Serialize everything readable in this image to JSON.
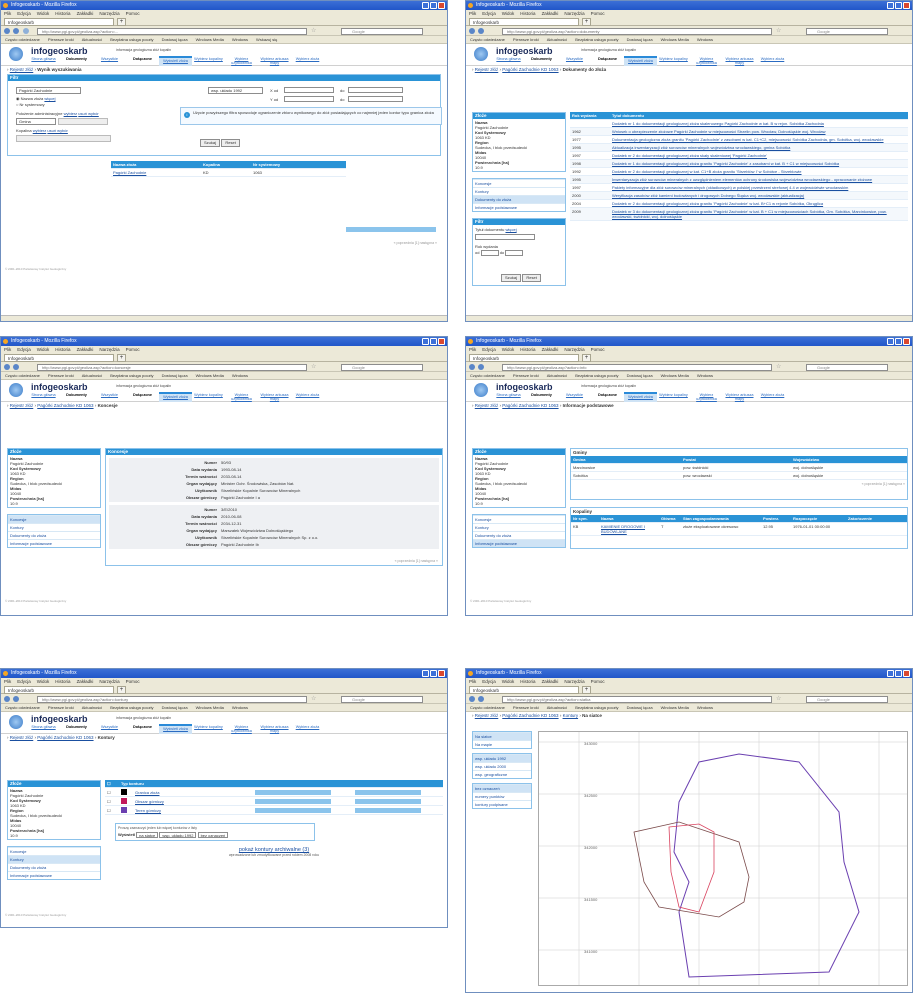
{
  "browser": {
    "title": "Infogeoskarb - Mozilla Firefox",
    "menu": [
      "Plik",
      "Edycja",
      "Widok",
      "Historia",
      "Zakładki",
      "Narzędzia",
      "Pomoc"
    ],
    "tab": "Infogeoskarb",
    "bookmarks": [
      "Często odwiedzane",
      "Pierwsze kroki",
      "Aktualności",
      "Bezpłatna usługa poczty",
      "Dostosuj łącza",
      "Windows Media",
      "Windows",
      "Wskazuj się"
    ],
    "search": "Google"
  },
  "site": {
    "logo": "infogeoskarb",
    "tagline": "informacja geologiczna złóż kopalin",
    "nav": [
      "Strona główna",
      "Dokumenty",
      "Wszystkie",
      "Dołączone",
      "Wyświetl złoża",
      "Wybierz kopaliny",
      "Wybierz użytkownika",
      "Wybierz arkusza mapy",
      "Wybierz złoża"
    ]
  },
  "colors": {
    "header": "#2a93d6",
    "link": "#1a4fa0",
    "frame": "#2156c9"
  },
  "w1": {
    "url": "http://www.pgi.gov.pl/geoliza.asp?action=...",
    "breadcrumb": [
      "Rejestr złóż",
      "Wynik wyszukiwania"
    ],
    "filter_header": "Filtr",
    "name_value": "Pagórki Zachodnie",
    "radio1": "Nazwa złoża",
    "radio2": "Nr systemowy",
    "admin_label": "Położenie administracyjne",
    "admin_link1": "wybierz",
    "admin_link2": "usuń wybór",
    "gmina": "Gmina",
    "kopalina_label": "Kopalina",
    "kop_link1": "wybierz",
    "kop_link2": "usuń wybór",
    "coord_select": "wsp. układu 1992",
    "x_label": "X od",
    "y_label": "Y od",
    "do": "do",
    "info": "Użycie powyższego filtra spowoduje ograniczenie zbioru wynikowego do złóż posiadających co najmniej jeden kontur typu granica złoża",
    "search_btn": "Szukaj",
    "reset_btn": "Reset",
    "col_name": "Nazwa złoża",
    "col_kop": "Kopalina",
    "col_nr": "Nr systemowy",
    "result_name": "Pagórki Zachodnie",
    "result_kop": "KD",
    "result_nr": "1063",
    "pager": "« poprzednia [1] następna »",
    "footer": "© 2001-2010 Państwowy Instytut Geologiczny"
  },
  "side": {
    "header": "Złoże",
    "nazwa_l": "Nazwa",
    "nazwa": "Pagórki Zachodnie",
    "kod_l": "Kod Systemowy",
    "kod": "1063 KD",
    "region_l": "Region",
    "region": "Sudecka, I blok przedsudecki",
    "midas_l": "Midas",
    "midas": "10040",
    "pow_l": "Powierzchnia [ha]",
    "pow": "10.9",
    "links": [
      "Koncesje",
      "Kontury",
      "Dokumenty do złoża",
      "Informacje podstawowe"
    ]
  },
  "w2": {
    "url": "http://www.pgi.gov.pl/geoliza.asp?action=dokumenty",
    "breadcrumb": [
      "Rejestr złóż",
      "Pagórki Zachodnie KD 1063",
      "Dokumenty do złoża"
    ],
    "col_year": "Rok wydania",
    "col_title": "Tytuł dokumentu",
    "docs": [
      {
        "y": "",
        "t": "Dodatek nr 1 do dokumentacji geologicznej złoża skalenowego Pagórki Zachodnie w kat. B w rejon. Sobótka Zachodnia"
      },
      {
        "y": "1962",
        "t": "Wniosek o ubezpieczenie złożowe Pagórki Zachodnie w miejscowości Strzelin pow. Wrocław, Dolnośląskie woj. Wrocław"
      },
      {
        "y": "1977",
        "t": "Dokumentacja geologiczna złoża granitu 'Pagórki Zachodnie' z zasobami w kat. C1+C2, miejscowość Sobótka Zachodnia, gm. Sobótka, woj. wrocławskie"
      },
      {
        "y": "1995",
        "t": "Aktualizacja inwentaryzacji złóż surowców mineralnych województwa wrocławskiego, gmina Sobótka"
      },
      {
        "y": "1997",
        "t": "Dodatek nr 2 do dokumentacji geologicznej złoża skały skaleniowej 'Pagórki Zachodnie'"
      },
      {
        "y": "1998",
        "t": "Dodatek nr 1 do dokumentacji geologicznej złoża granitu 'Pagórki Zachodnie' z zasobami w kat. B + C1 w miejscowości Sobótka"
      },
      {
        "y": "1992",
        "t": "Dodatek nr 2 do dokumentacji geologicznej w kat. C1+B złoża granitu 'Strzeblów I' w Sobótce - Strzeblowie"
      },
      {
        "y": "1995",
        "t": "Inwentaryzacja złóż surowców mineralnych z uwzględnieniem elementów ochrony środowiska województwa wrocławskiego - opracowanie złożowe"
      },
      {
        "y": "1997",
        "t": "Pakiety informacyjne dla złóż surowców mineralnych (okładkowych) w polskiej przestrzeni strefowej 4.4 w województwie wrocławskim"
      },
      {
        "y": "2000",
        "t": "Weryfikacja zasobów złóż kamieni budowlanych i drogowych Dolnego Śląska woj. wrocławskie (aktualizacja)"
      },
      {
        "y": "2004",
        "t": "Dodatek nr 2 do dokumentacji geologicznej złoża granitu 'Pagórki Zachodnie' w kat. B+C1 w rejonie Sobótka, Okrąglica"
      },
      {
        "y": "2009",
        "t": "Dodatek nr 3 do dokumentacji geologicznej złoża granitu 'Pagórki Zachodnie' w kat. B + C1 w miejscowościach Sobótka, Gm. Sobótka, Marcinkowice, pow. wrocławski, świdnicki, woj. dolnośląskie"
      }
    ],
    "filter_header": "Filtr",
    "doc_title_label": "Tytuł dokumentu",
    "doc_title_link": "więcej",
    "rok_label": "Rok wydania",
    "od": "od",
    "do": "do",
    "search_btn": "Szukaj",
    "reset_btn": "Reset"
  },
  "w3": {
    "url": "http://www.pgi.gov.pl/geoliza.asp?action=koncesje",
    "breadcrumb": [
      "Rejestr złóż",
      "Pagórki Zachodnie KD 1063",
      "Koncesje"
    ],
    "header": "Koncesje",
    "fields": [
      "Numer",
      "Data wydania",
      "Termin ważności",
      "Organ wydający",
      "Użytkownik",
      "Obszar górniczy"
    ],
    "k1": [
      "50/93",
      "1993-08-14",
      "2033-08-14",
      "Minister Ochr. Środowiska, Zasobów Nat.",
      "Strzelińskie Kopalnie Surowców Mineralnych",
      "Pagórki Zachodnie I a"
    ],
    "k2": [
      "3/E/2010",
      "2010-06-08",
      "2034-12-31",
      "Marszałek Województwa Dolnośląskiego",
      "Strzelińskie Kopalnie Surowców Mineralnych Sp. z o.o.",
      "Pagórki Zachodnie Ib"
    ],
    "pager": "« poprzednia [1] następna »"
  },
  "w4": {
    "url": "http://www.pgi.gov.pl/geoliza.asp?action=info",
    "breadcrumb": [
      "Rejestr złóż",
      "Pagórki Zachodnie KD 1063",
      "Informacje podstawowe"
    ],
    "gminy_header": "Gminy",
    "cols": [
      "Gmina",
      "Powiat",
      "Województwo"
    ],
    "gminy": [
      [
        "Marcinowice",
        "pow. świdnicki",
        "woj. dolnośląskie"
      ],
      [
        "Sobótka",
        "pow. wrocławski",
        "woj. dolnośląskie"
      ]
    ],
    "pager": "« poprzednia [1] następna »",
    "kop_header": "Kopaliny",
    "kop_cols": [
      "Nr sym.",
      "Nazwa",
      "Główna",
      "Stan zagospodarowania",
      "Powierz.",
      "Rozpoczęcie",
      "Zakończenie"
    ],
    "kop_row": [
      "KB",
      "KAMIENIE DROGOWE I BUDOWLANE",
      "T",
      "złoże eksploatowane okresowo",
      "12.95",
      "1976-01-01 00:00:00",
      ""
    ]
  },
  "w5": {
    "url": "http://www.pgi.gov.pl/geoliza.asp?action=kontury",
    "breadcrumb": [
      "Rejestr złóż",
      "Pagórki Zachodnie KD 1063",
      "Kontury"
    ],
    "header": "Typ konturu",
    "types": [
      {
        "name": "Granica złoża",
        "color": "#000000"
      },
      {
        "name": "Obszar górniczy",
        "color": "#c2185b"
      },
      {
        "name": "Teren górniczy",
        "color": "#6a3fb0"
      }
    ],
    "hint": "Proszę zaznaczyć jeden lub więcej konturów z listy",
    "show_label": "Wyświetl",
    "opt1": "na siatce",
    "opt2": "wsp. układu 1992",
    "opt3": "bez oznaczeń",
    "archive_link": "pokaż kontury archiwalne (3)",
    "archive_note": "wprowadzone lub zmodyfikowane przed rokiem 2008 roku"
  },
  "w6": {
    "url": "http://www.pgi.gov.pl/geoliza.asp?action=siatka",
    "breadcrumb": [
      "Rejestr złóż",
      "Pagórki Zachodnie KD 1063",
      "Kontury",
      "Na siatce"
    ],
    "side1": [
      "Na siatce",
      "Na mapie"
    ],
    "side2": [
      "wsp. układu 1992",
      "wsp. układu 2000",
      "wsp. geograficzne"
    ],
    "side3": [
      "bez oznaczeń",
      "numery punktów",
      "kontury podpisane"
    ],
    "y_ticks": [
      "343000",
      "342500",
      "342000",
      "341500",
      "341000"
    ]
  }
}
